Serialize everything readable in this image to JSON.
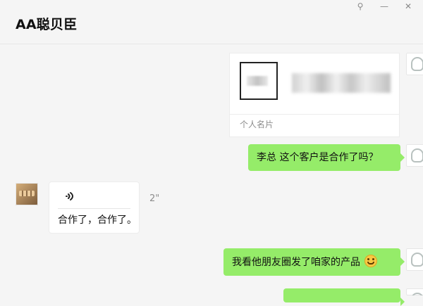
{
  "header": {
    "title": "AA聪贝臣",
    "controls": {
      "pin": "⚲",
      "minimize": "—",
      "close": "✕"
    }
  },
  "messages": {
    "card": {
      "label": "个人名片"
    },
    "msg1": {
      "text": "李总 这个客户是合作了吗？"
    },
    "voice": {
      "text": "合作了，合作了。",
      "duration": "2\""
    },
    "msg3": {
      "text": "我看他朋友圈发了咱家的产品"
    }
  },
  "icons": {
    "voice_icon": "voice-wave-icon",
    "emoji_icon": "laugh-cry-emoji-icon"
  },
  "colors": {
    "bubble_green": "#95ec69",
    "background": "#f5f5f5"
  }
}
